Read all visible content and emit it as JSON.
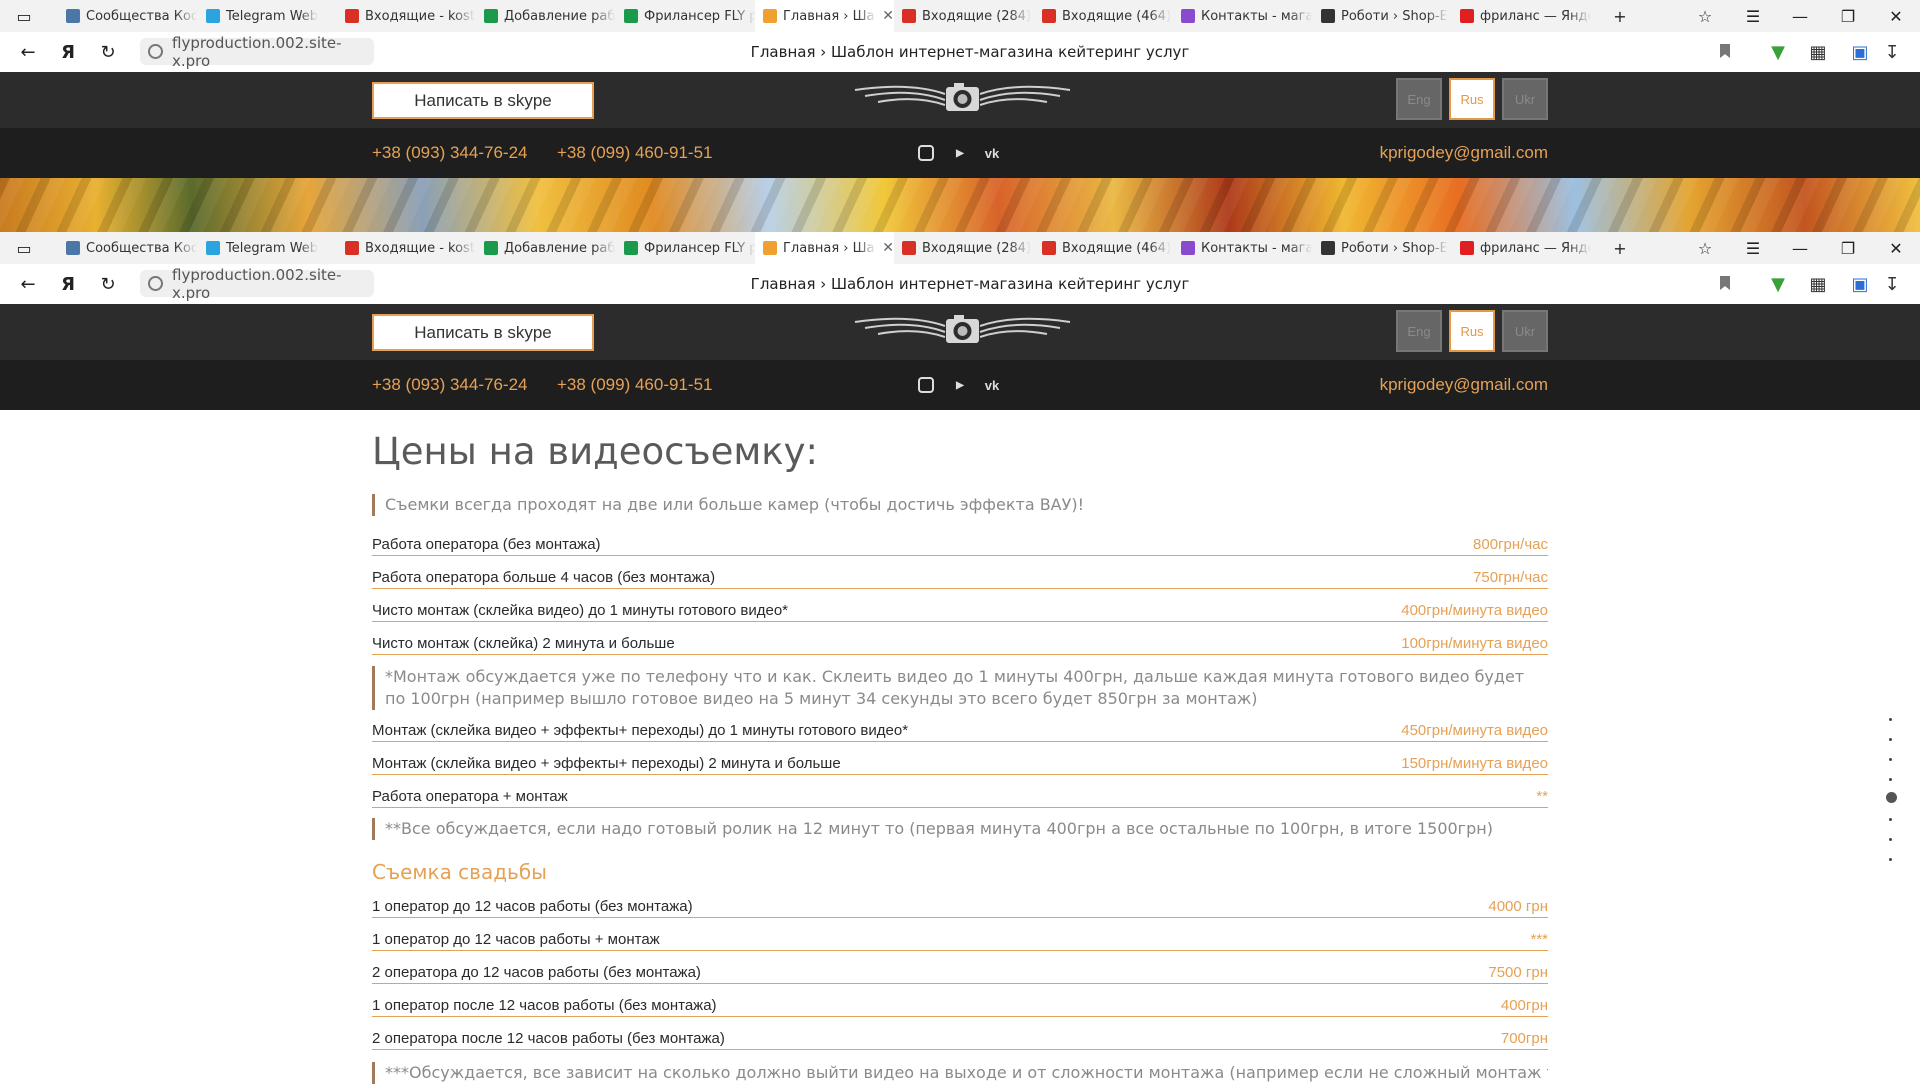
{
  "browser": {
    "tabs": [
      {
        "label": "Сообщества Кос",
        "icon": "vk-icon",
        "color": "#4a76a8"
      },
      {
        "label": "Telegram Web",
        "icon": "telegram-icon",
        "color": "#2aa3df"
      },
      {
        "label": "Входящие - kost",
        "icon": "gmail-icon",
        "color": "#d93025"
      },
      {
        "label": "Добавление раб",
        "icon": "sheets-icon",
        "color": "#1a9a4a"
      },
      {
        "label": "Фрилансер FLY р",
        "icon": "sheets-icon",
        "color": "#1a9a4a"
      },
      {
        "label": "Главная › Шаб",
        "icon": "map-pin-icon",
        "color": "#f0a030",
        "active": true
      },
      {
        "label": "Входящие (284)",
        "icon": "gmail-icon",
        "color": "#d93025"
      },
      {
        "label": "Входящие (464)",
        "icon": "gmail-icon",
        "color": "#d93025"
      },
      {
        "label": "Контакты - мага",
        "icon": "puzzle-icon",
        "color": "#8a4ad0"
      },
      {
        "label": "Роботи › Shop-E",
        "icon": "shop-icon",
        "color": "#333333"
      },
      {
        "label": "фриланс — Янде",
        "icon": "yandex-icon",
        "color": "#e02020"
      }
    ],
    "url": "flyproduction.002.site-x.pro",
    "page_title": "Главная › Шаблон интернет-магазина кейтеринг услуг"
  },
  "site": {
    "skype_label": "Написать в skype",
    "langs": [
      "Eng",
      "Rus",
      "Ukr"
    ],
    "active_lang": "Rus",
    "phone1": "+38 (093) 344-76-24",
    "phone2": "+38 (099) 460-91-51",
    "email": "kprigodey@gmail.com",
    "social": [
      "instagram-icon",
      "youtube-icon",
      "vk-icon"
    ]
  },
  "prices": {
    "title": "Цены на видеосъемку:",
    "note1": "Съемки всегда проходят на две или больше камер (чтобы достичь эффекта ВАУ)!",
    "rows1": [
      {
        "name": "Работа оператора (без монтажа)",
        "price": "800грн/час"
      },
      {
        "name": "Работа оператора больше 4 часов (без монтажа)",
        "price": "750грн/час"
      },
      {
        "name": "Чисто монтаж (склейка видео) до 1 минуты готового видео*",
        "price": "400грн/минута видео"
      },
      {
        "name": "Чисто монтаж (склейка) 2 минута и больше",
        "price": "100грн/минута видео"
      }
    ],
    "note2": "*Монтаж обсуждается уже по телефону что и как. Склеить видео до 1 минуты 400грн, дальше каждая минута готового видео будет по 100грн (например вышло готовое видео на 5 минут 34 секунды это всего будет 850грн за монтаж)",
    "rows2": [
      {
        "name": "Монтаж (склейка видео + эффекты+ переходы) до 1 минуты готового видео*",
        "price": "450грн/минута видео"
      },
      {
        "name": "Монтаж (склейка видео + эффекты+ переходы) 2 минута и больше",
        "price": "150грн/минута видео"
      },
      {
        "name": "Работа оператора + монтаж",
        "price": "**"
      }
    ],
    "note3": "**Все обсуждается, если надо готовый ролик на 12 минут то (первая минута 400грн а все остальные по 100грн, в итоге 1500грн)",
    "wedding_title": "Съемка свадьбы",
    "rows3": [
      {
        "name": "1 оператор до 12 часов работы (без монтажа)",
        "price": "4000 грн"
      },
      {
        "name": "1 оператор до 12 часов работы + монтаж",
        "price": "***"
      },
      {
        "name": "2 оператора до 12 часов работы (без монтажа)",
        "price": "7500 грн"
      },
      {
        "name": "1 оператор после 12 часов работы (без монтажа)",
        "price": "400грн"
      },
      {
        "name": "2 оператора после 12 часов работы (без монтажа)",
        "price": "700грн"
      }
    ],
    "note4": "***Обсуждается, все зависит на сколько должно выйти видео на выходе и от сложности монтажа (например если не сложный монтаж то"
  }
}
